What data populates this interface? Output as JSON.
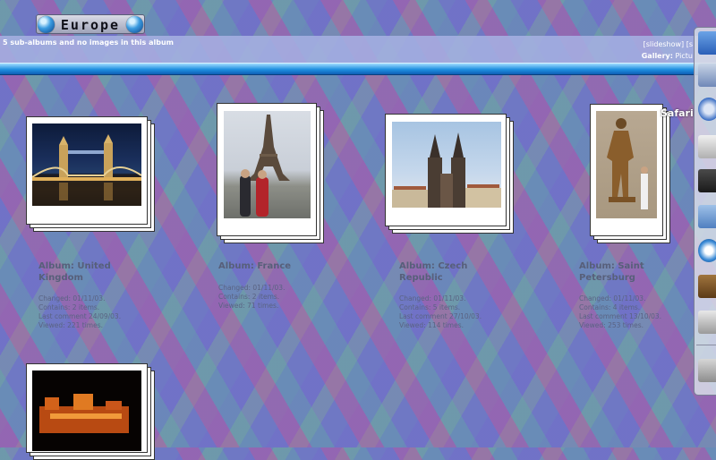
{
  "header": {
    "title": "Europe"
  },
  "info_bar": {
    "summary": "5 sub-albums and no images in this album",
    "slideshow_link": "[slideshow]",
    "slideshow_cut": "[s",
    "gallery_label": "Gallery:",
    "gallery_value": "Pictu"
  },
  "albums": [
    {
      "title": "Album: United Kingdom",
      "changed": "Changed: 01/11/03.",
      "contains": "Contains: 2 items.",
      "last_comment": "Last comment 24/09/03.",
      "viewed": "Viewed: 221 times."
    },
    {
      "title": "Album: France",
      "changed": "Changed: 01/11/03.",
      "contains": "Contains: 2 items.",
      "viewed": "Viewed: 71 times."
    },
    {
      "title": "Album: Czech Republic",
      "changed": "Changed: 01/11/03.",
      "contains": "Contains: 5 items.",
      "last_comment": "Last comment 27/10/03.",
      "viewed": "Viewed: 114 times."
    },
    {
      "title": "Album: Saint Petersburg",
      "changed": "Changed: 01/11/03.",
      "contains": "Contains: 4 items.",
      "last_comment": "Last comment 13/10/03.",
      "viewed": "Viewed: 253 times."
    }
  ],
  "dock": {
    "hover_label": "Safari",
    "items": [
      "finder-icon",
      "mail-icon",
      "safari-icon",
      "timer-icon",
      "terminal-icon",
      "photos-icon",
      "itunes-icon",
      "address-book-icon",
      "utility-icon",
      "trash-icon"
    ]
  },
  "colors": {
    "accent_bar": "#1f8fe0",
    "info_bar": "#a5afe1"
  }
}
